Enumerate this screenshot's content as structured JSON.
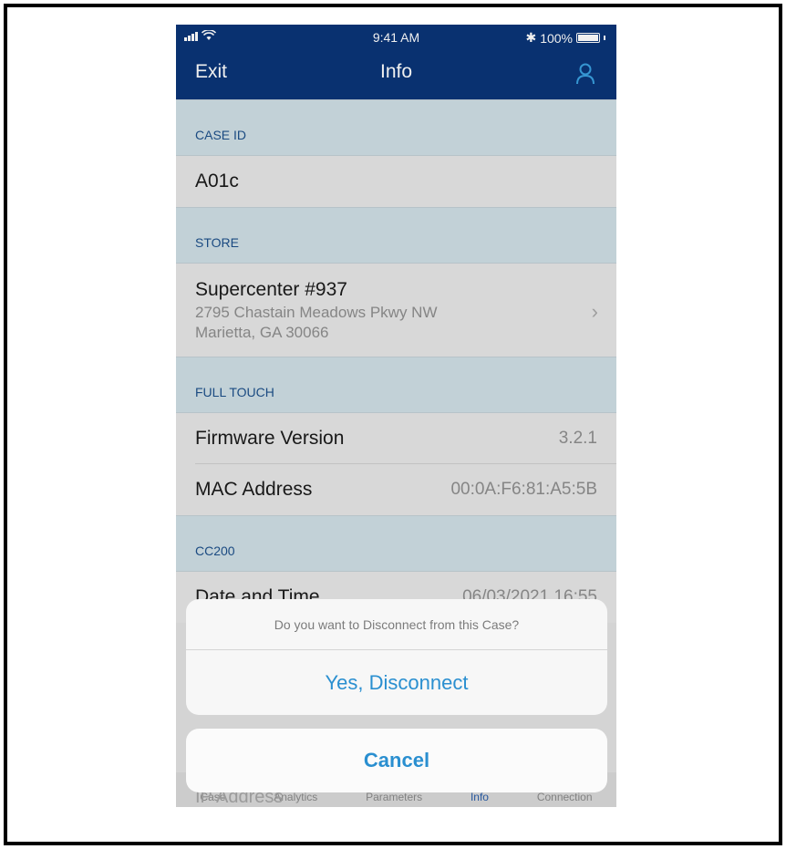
{
  "status_bar": {
    "time": "9:41 AM",
    "battery": "100%",
    "icons": [
      "signal-icon",
      "wifi-icon",
      "bluetooth-icon",
      "battery-icon"
    ]
  },
  "nav": {
    "exit_label": "Exit",
    "title": "Info",
    "profile_icon": "person-icon"
  },
  "sections": {
    "case_id": {
      "header": "CASE ID",
      "value": "A01c"
    },
    "store": {
      "header": "STORE",
      "name": "Supercenter #937",
      "address_line1": "2795 Chastain Meadows Pkwy NW",
      "address_line2": "Marietta, GA 30066"
    },
    "full_touch": {
      "header": "FULL TOUCH",
      "rows": [
        {
          "label": "Firmware Version",
          "value": "3.2.1"
        },
        {
          "label": "MAC Address",
          "value": "00:0A:F6:81:A5:5B"
        }
      ]
    },
    "cc200": {
      "header": "CC200",
      "rows": [
        {
          "label": "Date and Time",
          "value": "06/03/2021 16:55"
        }
      ]
    }
  },
  "behind_sheet": {
    "partial_row_label": "IP Address",
    "tabs": [
      "Case",
      "Analytics",
      "Parameters",
      "Info",
      "Connection"
    ]
  },
  "action_sheet": {
    "message": "Do you want to Disconnect from this Case?",
    "confirm_label": "Yes, Disconnect",
    "cancel_label": "Cancel"
  },
  "colors": {
    "nav_bg": "#0a3577",
    "section_bg": "#cfdfe5",
    "action_blue": "#2a8fd0"
  }
}
